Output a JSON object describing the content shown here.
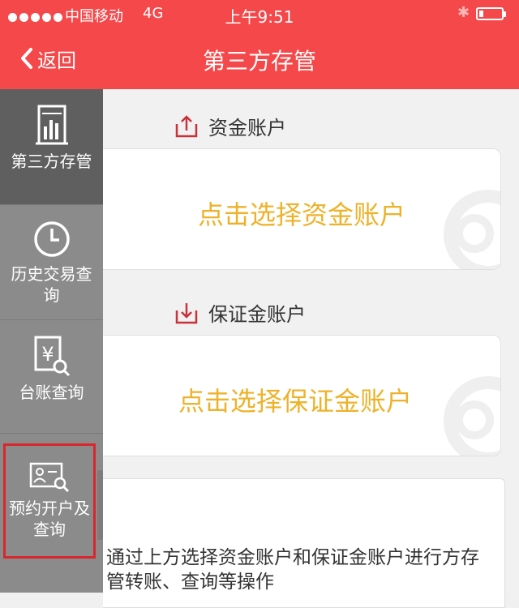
{
  "status_bar": {
    "carrier": "中国移动",
    "network": "4G",
    "time": "上午9:51"
  },
  "nav": {
    "back_label": "返回",
    "title": "第三方存管"
  },
  "sidebar": {
    "items": [
      {
        "label": "第三方存管",
        "icon": "building-chart-icon",
        "active": true
      },
      {
        "label": "历史交易查询",
        "icon": "clock-icon",
        "active": false
      },
      {
        "label": "台账查询",
        "icon": "yen-search-icon",
        "active": false
      },
      {
        "label": "预约开户及查询",
        "icon": "id-card-search-icon",
        "active": false,
        "highlighted": true
      }
    ]
  },
  "main": {
    "fund_account": {
      "heading": "资金账户",
      "icon": "upload-icon",
      "prompt": "点击选择资金账户"
    },
    "margin_account": {
      "heading": "保证金账户",
      "icon": "download-icon",
      "prompt": "点击选择保证金账户"
    },
    "note": "通过上方选择资金账户和保证金账户进行方存管转账、查询等操作"
  },
  "colors": {
    "header": "#f4484a",
    "sidebar": "#8b8b8b",
    "sidebar_active": "#5f5f5f",
    "prompt_text": "#eeb22a",
    "icon_red": "#c8323a",
    "highlight_box": "#d9262c"
  }
}
